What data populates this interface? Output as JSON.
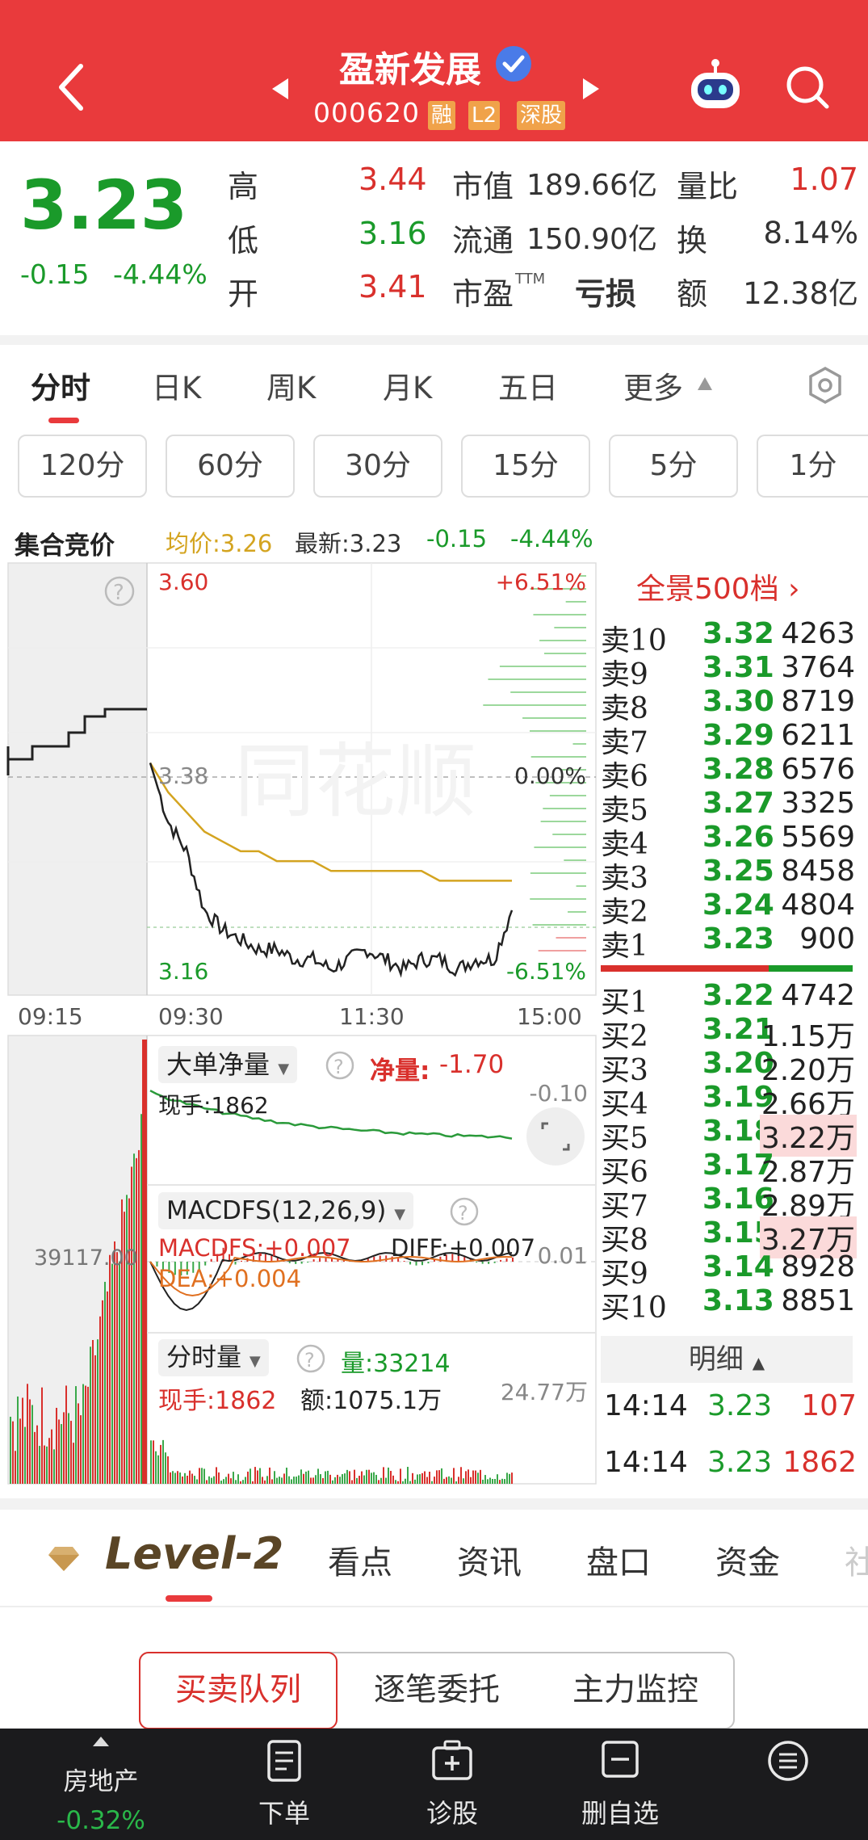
{
  "header": {
    "title": "盈新发展",
    "code": "000620",
    "badges": [
      "融",
      "L2",
      "深股"
    ]
  },
  "quote": {
    "price": "3.23",
    "change": "-0.15",
    "change_pct": "-4.44%",
    "high_label": "高",
    "high": "3.44",
    "low_label": "低",
    "low": "3.16",
    "open_label": "开",
    "open": "3.41",
    "mcap_label": "市值",
    "mcap": "189.66亿",
    "float_label": "流通",
    "float": "150.90亿",
    "pe_label": "市盈",
    "pe_suffix": "TTM",
    "pe": "亏损",
    "vr_label": "量比",
    "vr": "1.07",
    "turn_label": "换",
    "turn": "8.14%",
    "amt_label": "额",
    "amt": "12.38亿"
  },
  "tabs": [
    "分时",
    "日K",
    "周K",
    "月K",
    "五日",
    "更多"
  ],
  "periods": [
    "120分",
    "60分",
    "30分",
    "15分",
    "5分",
    "1分"
  ],
  "infobar": {
    "label": "集合竞价",
    "avg": "均价:3.26",
    "latest": "最新:3.23",
    "chg": "-0.15",
    "pct": "-4.44%"
  },
  "chart_data": {
    "type": "line",
    "series": [
      {
        "values": [
          3.38,
          3.35,
          3.33,
          3.31,
          3.3,
          3.29,
          3.29,
          3.28,
          3.28,
          3.28,
          3.27,
          3.27,
          3.27,
          3.27,
          3.27,
          3.27,
          3.26,
          3.26,
          3.26,
          3.26,
          3.26
        ]
      },
      {
        "values": [
          3.38,
          3.32,
          3.29,
          3.23,
          3.21,
          3.2,
          3.19,
          3.19,
          3.18,
          3.18,
          3.17,
          3.18,
          3.19,
          3.18,
          3.17,
          3.18,
          3.18,
          3.17,
          3.18,
          3.18,
          3.23
        ]
      }
    ],
    "ylim": [
      3.16,
      3.6
    ],
    "y_labels": {
      "top": "3.60",
      "mid": "3.38",
      "bottom": "3.16"
    },
    "pct_labels": {
      "top": "+6.51%",
      "mid": "0.00%",
      "bottom": "-6.51%"
    },
    "x_ticks": [
      "09:15",
      "09:30",
      "11:30",
      "15:00"
    ],
    "auction_label": "39117.00",
    "panels": {
      "big_order": {
        "title": "大单净量",
        "net_label": "净量:",
        "net": "-1.70",
        "hand": "现手:1862",
        "scale": "-0.10"
      },
      "macd": {
        "title": "MACDFS(12,26,9)",
        "macd": "MACDFS:+0.007",
        "diff": "DIFF:+0.007",
        "dea": "DEA:+0.004",
        "scale": "0.01"
      },
      "volume": {
        "title": "分时量",
        "vol": "量:33214",
        "hand": "现手:1862",
        "amt": "额:1075.1万",
        "scale": "24.77万"
      }
    }
  },
  "orderbook": {
    "title": "全景500档",
    "asks": [
      {
        "label": "卖10",
        "price": "3.32",
        "vol": "4263"
      },
      {
        "label": "卖9",
        "price": "3.31",
        "vol": "3764"
      },
      {
        "label": "卖8",
        "price": "3.30",
        "vol": "8719"
      },
      {
        "label": "卖7",
        "price": "3.29",
        "vol": "6211"
      },
      {
        "label": "卖6",
        "price": "3.28",
        "vol": "6576"
      },
      {
        "label": "卖5",
        "price": "3.27",
        "vol": "3325"
      },
      {
        "label": "卖4",
        "price": "3.26",
        "vol": "5569"
      },
      {
        "label": "卖3",
        "price": "3.25",
        "vol": "8458"
      },
      {
        "label": "卖2",
        "price": "3.24",
        "vol": "4804"
      },
      {
        "label": "卖1",
        "price": "3.23",
        "vol": "900"
      }
    ],
    "bids": [
      {
        "label": "买1",
        "price": "3.22",
        "vol": "4742"
      },
      {
        "label": "买2",
        "price": "3.21",
        "vol": "1.15万"
      },
      {
        "label": "买3",
        "price": "3.20",
        "vol": "2.20万"
      },
      {
        "label": "买4",
        "price": "3.19",
        "vol": "2.66万"
      },
      {
        "label": "买5",
        "price": "3.18",
        "vol": "3.22万"
      },
      {
        "label": "买6",
        "price": "3.17",
        "vol": "2.87万"
      },
      {
        "label": "买7",
        "price": "3.16",
        "vol": "2.89万"
      },
      {
        "label": "买8",
        "price": "3.15",
        "vol": "3.27万"
      },
      {
        "label": "买9",
        "price": "3.14",
        "vol": "8928"
      },
      {
        "label": "买10",
        "price": "3.13",
        "vol": "8851"
      }
    ],
    "detail_label": "明细",
    "trades": [
      {
        "time": "14:14",
        "price": "3.23",
        "vol": "107"
      },
      {
        "time": "14:14",
        "price": "3.23",
        "vol": "1862"
      }
    ]
  },
  "level2": {
    "brand": "Level-2",
    "tabs": [
      "看点",
      "资讯",
      "盘口",
      "资金",
      "社"
    ],
    "subtabs": [
      "买卖队列",
      "逐笔委托",
      "主力监控"
    ]
  },
  "bottom_nav": {
    "sector": "房地产",
    "sector_pct": "-0.32%",
    "items": [
      "下单",
      "诊股",
      "删自选"
    ]
  },
  "colors": {
    "brand_red": "#e93a3c",
    "down_green": "#1a9a2a",
    "up_red": "#d9302c",
    "avg_yellow": "#d4a420"
  }
}
